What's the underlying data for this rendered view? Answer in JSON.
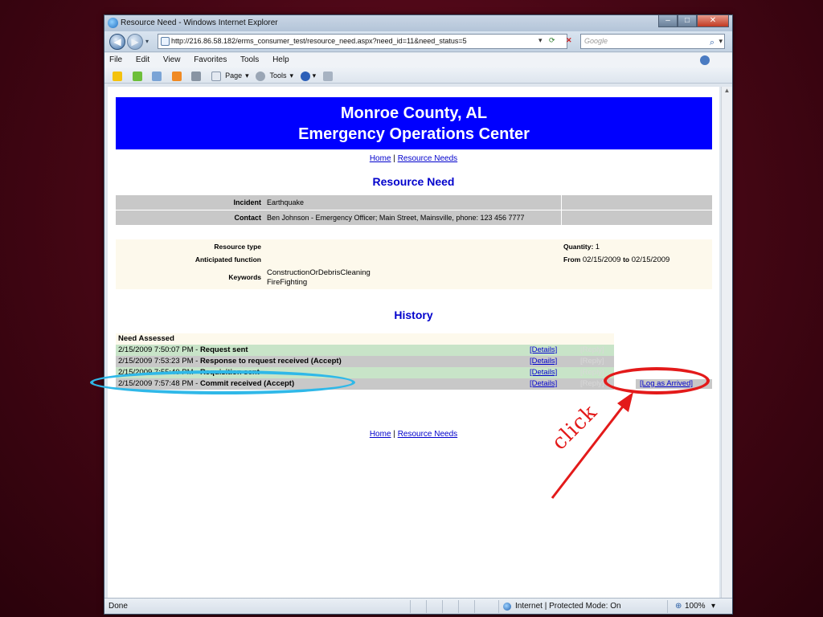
{
  "window": {
    "title": "Resource Need - Windows Internet Explorer",
    "url": "http://216.86.58.182/erms_consumer_test/resource_need.aspx?need_id=11&need_status=5",
    "search_placeholder": "Google",
    "menu": [
      "File",
      "Edit",
      "View",
      "Favorites",
      "Tools",
      "Help"
    ],
    "cmd_page": "Page",
    "cmd_tools": "Tools",
    "status_left": "Done",
    "status_zone": "Internet | Protected Mode: On",
    "zoom": "100%"
  },
  "page": {
    "banner_line1": "Monroe County, AL",
    "banner_line2": "Emergency Operations Center",
    "nav_home": "Home",
    "nav_sep": "|",
    "nav_resource_needs": "Resource Needs",
    "title": "Resource Need",
    "incident_label": "Incident",
    "incident_value": "Earthquake",
    "contact_label": "Contact",
    "contact_value": "Ben Johnson - Emergency Officer;  Main Street, Mainsville, phone: 123 456 7777",
    "resource_type_label": "Resource type",
    "anticipated_function_label": "Anticipated function",
    "keywords_label": "Keywords",
    "keywords": [
      "ConstructionOrDebrisCleaning",
      "FireFighting"
    ],
    "quantity_label": "Quantity:",
    "quantity_value": "1",
    "from_label": "From",
    "from_date": "02/15/2009",
    "to_label": "to",
    "to_date": "02/15/2009",
    "history_title": "History",
    "history_header": "Need Assessed",
    "history": [
      {
        "time": "2/15/2009 7:50:07 PM - ",
        "event": "Request sent",
        "details": "[Details]",
        "reply": "[Reply]"
      },
      {
        "time": "2/15/2009 7:53:23 PM - ",
        "event": "Response to request received (Accept)",
        "details": "[Details]",
        "reply": "[Reply]"
      },
      {
        "time": "2/15/2009 7:55:40 PM - ",
        "event": "Requisition sent",
        "details": "[Details]",
        "reply": "[Reply]"
      },
      {
        "time": "2/15/2009 7:57:48 PM - ",
        "event": "Commit received (Accept)",
        "details": "[Details]",
        "reply": "[Reply]",
        "action": "[Log as Arrived]"
      }
    ]
  },
  "annotation": {
    "click_text": "click",
    "ellipse_blue_color": "#2fb8e8",
    "ellipse_red_color": "#e31a1a"
  }
}
